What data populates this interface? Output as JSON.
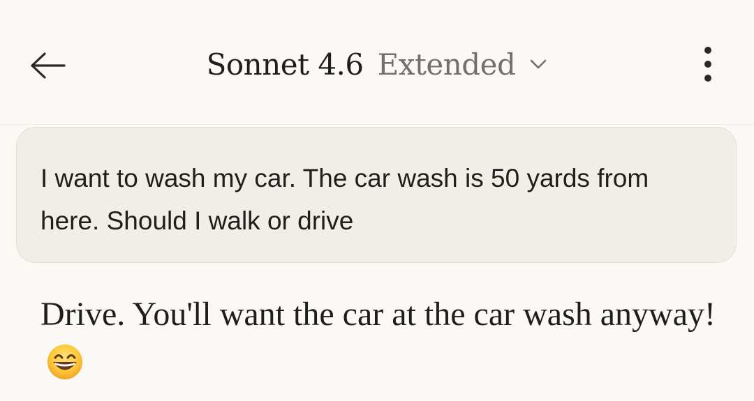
{
  "header": {
    "model_name": "Sonnet 4.6",
    "mode_label": "Extended",
    "back_icon": "arrow-left-icon",
    "dropdown_icon": "chevron-down-icon",
    "menu_icon": "more-vertical-icon"
  },
  "conversation": {
    "user_message": "I want to wash my car. The car wash is 50 yards from here. Should I walk or drive",
    "assistant_reply": "Drive. You'll want the car at the car wash anyway!",
    "reply_emoji": "grinning-face-with-smiling-eyes-icon"
  },
  "colors": {
    "background": "#faf9f5",
    "user_bubble": "#f0eee6",
    "text_primary": "#1f1e1d",
    "text_secondary": "#737069"
  }
}
